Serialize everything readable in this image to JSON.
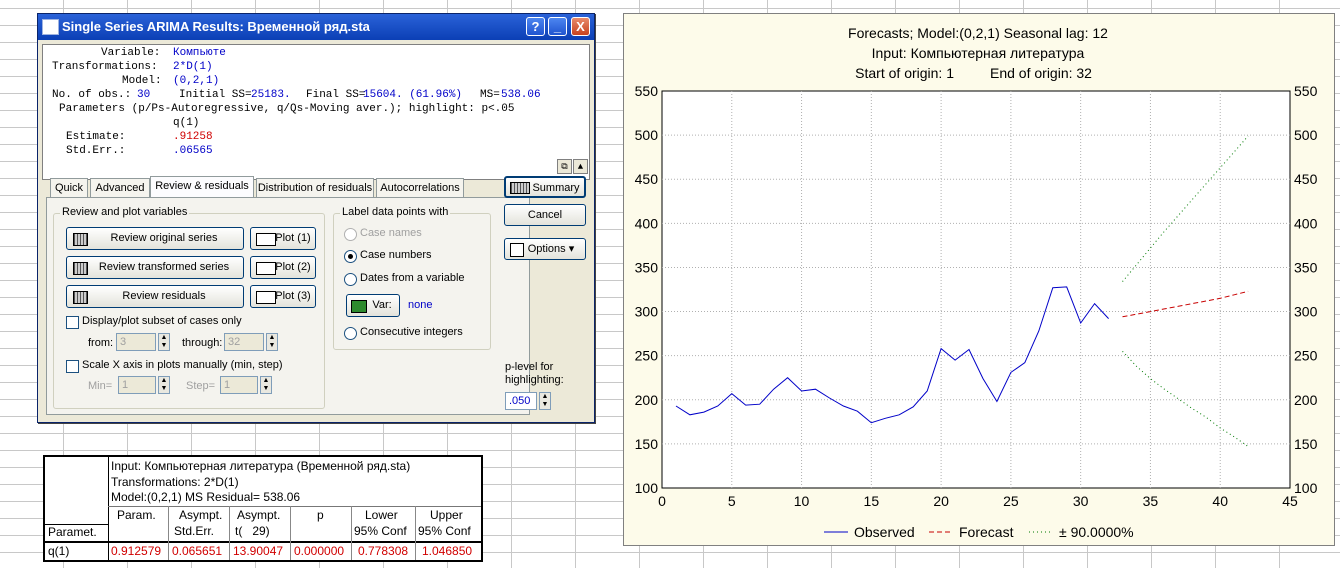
{
  "dialog": {
    "title": "Single Series ARIMA Results: Временной ряд.sta",
    "title_buttons": {
      "help": "?",
      "minimize": "_",
      "close": "X"
    },
    "output": {
      "variable_label": "Variable:",
      "variable_value": "Компьюте",
      "transformations_label": "Transformations:",
      "transformations_value": "2*D(1)",
      "model_label": "Model:",
      "model_value": "(0,2,1)",
      "nobs_label": "No. of obs.:",
      "nobs_value": "30",
      "initial_ss_label": "Initial SS=",
      "initial_ss_value": "25183.",
      "final_ss_label": "Final SS=",
      "final_ss_value": "15604. (61.96%)",
      "ms_label": "MS=",
      "ms_value": "538.06",
      "parameters_line": "Parameters (p/Ps-Autoregressive, q/Qs-Moving aver.); highlight: p<.05",
      "param_header": "q(1)",
      "estimate_label": "Estimate:",
      "estimate_value": ".91258",
      "stderr_label": "Std.Err.:",
      "stderr_value": ".06565"
    },
    "tabs": [
      "Quick",
      "Advanced",
      "Review & residuals",
      "Distribution of residuals",
      "Autocorrelations"
    ],
    "active_tab": "Review & residuals",
    "side_buttons": {
      "summary": "Summary",
      "cancel": "Cancel",
      "options": "Options"
    },
    "review": {
      "group_title": "Review and plot variables",
      "review_original": "Review original series",
      "review_transformed": "Review transformed series",
      "review_residuals": "Review residuals",
      "plot1": "Plot (1)",
      "plot2": "Plot (2)",
      "plot3": "Plot (3)",
      "subset_label": "Display/plot subset of cases only",
      "from_label": "from:",
      "from_value": "3",
      "through_label": "through:",
      "through_value": "32",
      "scale_label": "Scale X axis in plots manually (min, step)",
      "min_label": "Min=",
      "min_value": "1",
      "step_label": "Step=",
      "step_value": "1"
    },
    "label_points": {
      "group_title": "Label data points with",
      "case_names": "Case names",
      "case_numbers": "Case numbers",
      "dates": "Dates from a variable",
      "var_button": "Var:",
      "var_value": "none",
      "consecutive": "Consecutive integers"
    },
    "plevel": {
      "label_line1": "p-level for",
      "label_line2": "highlighting:",
      "value": ".050"
    }
  },
  "results_table": {
    "input_line": "Input: Компьютерная литература (Временной ряд.sta)",
    "transform_line": "Transformations: 2*D(1)",
    "model_line": "Model:(0,2,1) MS Residual= 538.06",
    "row_header": "Paramet.",
    "columns": [
      {
        "line1": "Param.",
        "line2": ""
      },
      {
        "line1": "Asympt.",
        "line2": "Std.Err."
      },
      {
        "line1": "Asympt.",
        "line2": "t(   29)"
      },
      {
        "line1": "p",
        "line2": ""
      },
      {
        "line1": "Lower",
        "line2": "95% Conf"
      },
      {
        "line1": "Upper",
        "line2": "95% Conf"
      }
    ],
    "row_label": "q(1)",
    "row_values": [
      "0.912579",
      "0.065651",
      "13.90047",
      "0.000000",
      "0.778308",
      "1.046850"
    ]
  },
  "chart_data": {
    "type": "line",
    "title": "Forecasts; Model:(0,2,1) Seasonal lag: 12",
    "subtitle1": "Input: Компьютерная литература",
    "subtitle2_left": "Start of origin: 1",
    "subtitle2_right": "End of origin: 32",
    "xlim": [
      0,
      45
    ],
    "ylim": [
      100,
      550
    ],
    "x_ticks": [
      0,
      5,
      10,
      15,
      20,
      25,
      30,
      35,
      40,
      45
    ],
    "y_ticks": [
      100,
      150,
      200,
      250,
      300,
      350,
      400,
      450,
      500,
      550
    ],
    "grid": true,
    "legend_position": "bottom",
    "series": [
      {
        "name": "Observed",
        "color": "#0000c8",
        "style": "solid",
        "x": [
          1,
          2,
          3,
          4,
          5,
          6,
          7,
          8,
          9,
          10,
          11,
          12,
          13,
          14,
          15,
          16,
          17,
          18,
          19,
          20,
          21,
          22,
          23,
          24,
          25,
          26,
          27,
          28,
          29,
          30,
          31,
          32
        ],
        "y": [
          193,
          183,
          186,
          193,
          207,
          194,
          195,
          212,
          225,
          210,
          212,
          202,
          193,
          187,
          174,
          179,
          183,
          192,
          210,
          258,
          245,
          257,
          224,
          198,
          231,
          242,
          278,
          327,
          328,
          287,
          309,
          292
        ]
      },
      {
        "name": "Forecast",
        "color": "#c80000",
        "style": "dashed",
        "x": [
          33,
          34,
          35,
          36,
          37,
          38,
          39,
          40,
          41,
          42
        ],
        "y": [
          294,
          297,
          300,
          303,
          306,
          309,
          312,
          315,
          319,
          323
        ]
      },
      {
        "name": "± 90.0000%",
        "color": "#007a00",
        "style": "dotted",
        "x": [
          33,
          34,
          35,
          36,
          37,
          38,
          39,
          40,
          41,
          42
        ],
        "y_upper": [
          334,
          353,
          372,
          391,
          409,
          427,
          445,
          463,
          481,
          499
        ],
        "y_lower": [
          255,
          238,
          224,
          212,
          201,
          190,
          180,
          168,
          158,
          147
        ]
      }
    ]
  }
}
